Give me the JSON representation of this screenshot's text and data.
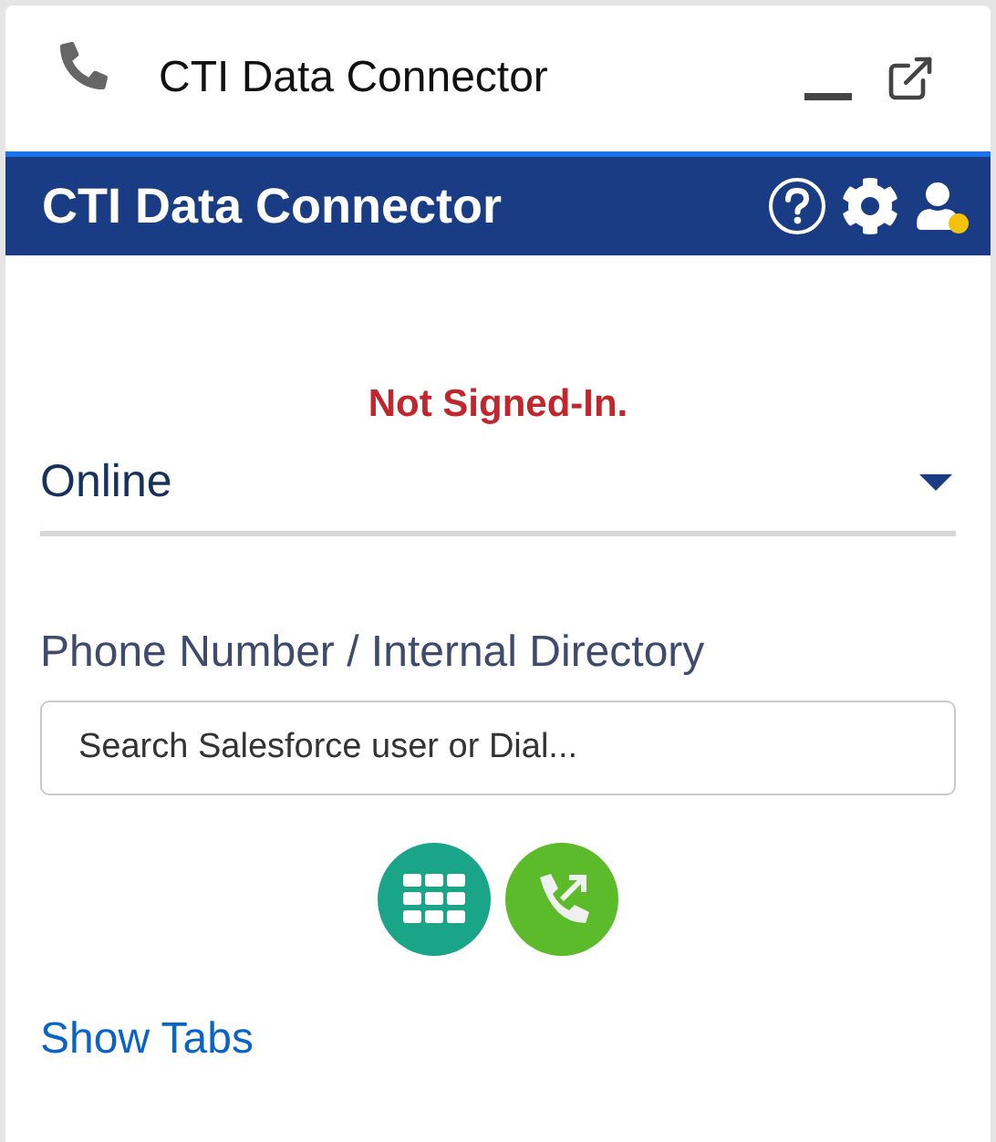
{
  "window": {
    "title": "CTI Data Connector"
  },
  "header": {
    "title": "CTI Data Connector"
  },
  "status_message": "Not Signed-In.",
  "presence": {
    "value": "Online"
  },
  "dial": {
    "label": "Phone Number / Internal Directory",
    "placeholder": "Search Salesforce user or Dial..."
  },
  "show_tabs_link": "Show Tabs"
}
